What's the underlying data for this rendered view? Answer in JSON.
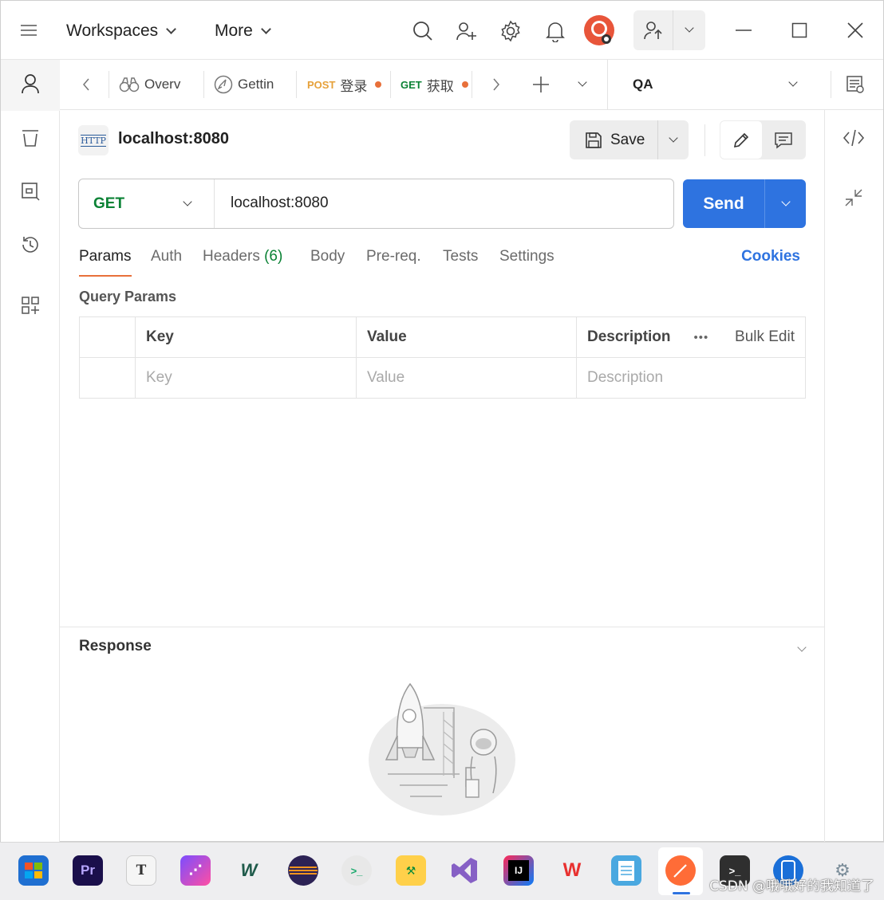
{
  "topbar": {
    "workspaces_label": "Workspaces",
    "more_label": "More"
  },
  "tabs": {
    "items": [
      {
        "label": "Overv",
        "method": ""
      },
      {
        "label": "Gettin",
        "method": ""
      },
      {
        "label": "登录",
        "method": "POST",
        "method_color": "#e6a13a",
        "unsaved": true
      },
      {
        "label": "获取",
        "method": "GET",
        "method_color": "#0b8235",
        "unsaved": true
      }
    ],
    "environment": "QA"
  },
  "request": {
    "title": "localhost:8080",
    "http_badge": "HTTP",
    "save_label": "Save",
    "method": "GET",
    "url": "localhost:8080",
    "send_label": "Send"
  },
  "subtabs": {
    "params": "Params",
    "auth": "Auth",
    "headers": "Headers",
    "headers_count": "(6)",
    "body": "Body",
    "prereq": "Pre-req.",
    "tests": "Tests",
    "settings": "Settings",
    "cookies": "Cookies"
  },
  "query_params": {
    "label": "Query Params",
    "columns": {
      "key": "Key",
      "value": "Value",
      "description": "Description"
    },
    "bulk_edit": "Bulk Edit",
    "placeholder": {
      "key": "Key",
      "value": "Value",
      "description": "Description"
    }
  },
  "response": {
    "title": "Response"
  },
  "colors": {
    "accent": "#2e73e0",
    "active_tab_underline": "#e8703a",
    "get_method": "#0b8235"
  },
  "taskbar": {
    "apps": [
      "store",
      "premiere-pro",
      "typora",
      "kaiten",
      "webstorm-like",
      "eclipse",
      "wechat-dev",
      "app-manager",
      "visual-studio",
      "intellij-idea",
      "wps-office",
      "notepad",
      "postman",
      "terminal",
      "phone-link",
      "settings"
    ]
  },
  "watermark": "CSDN @哦哦好的我知道了"
}
